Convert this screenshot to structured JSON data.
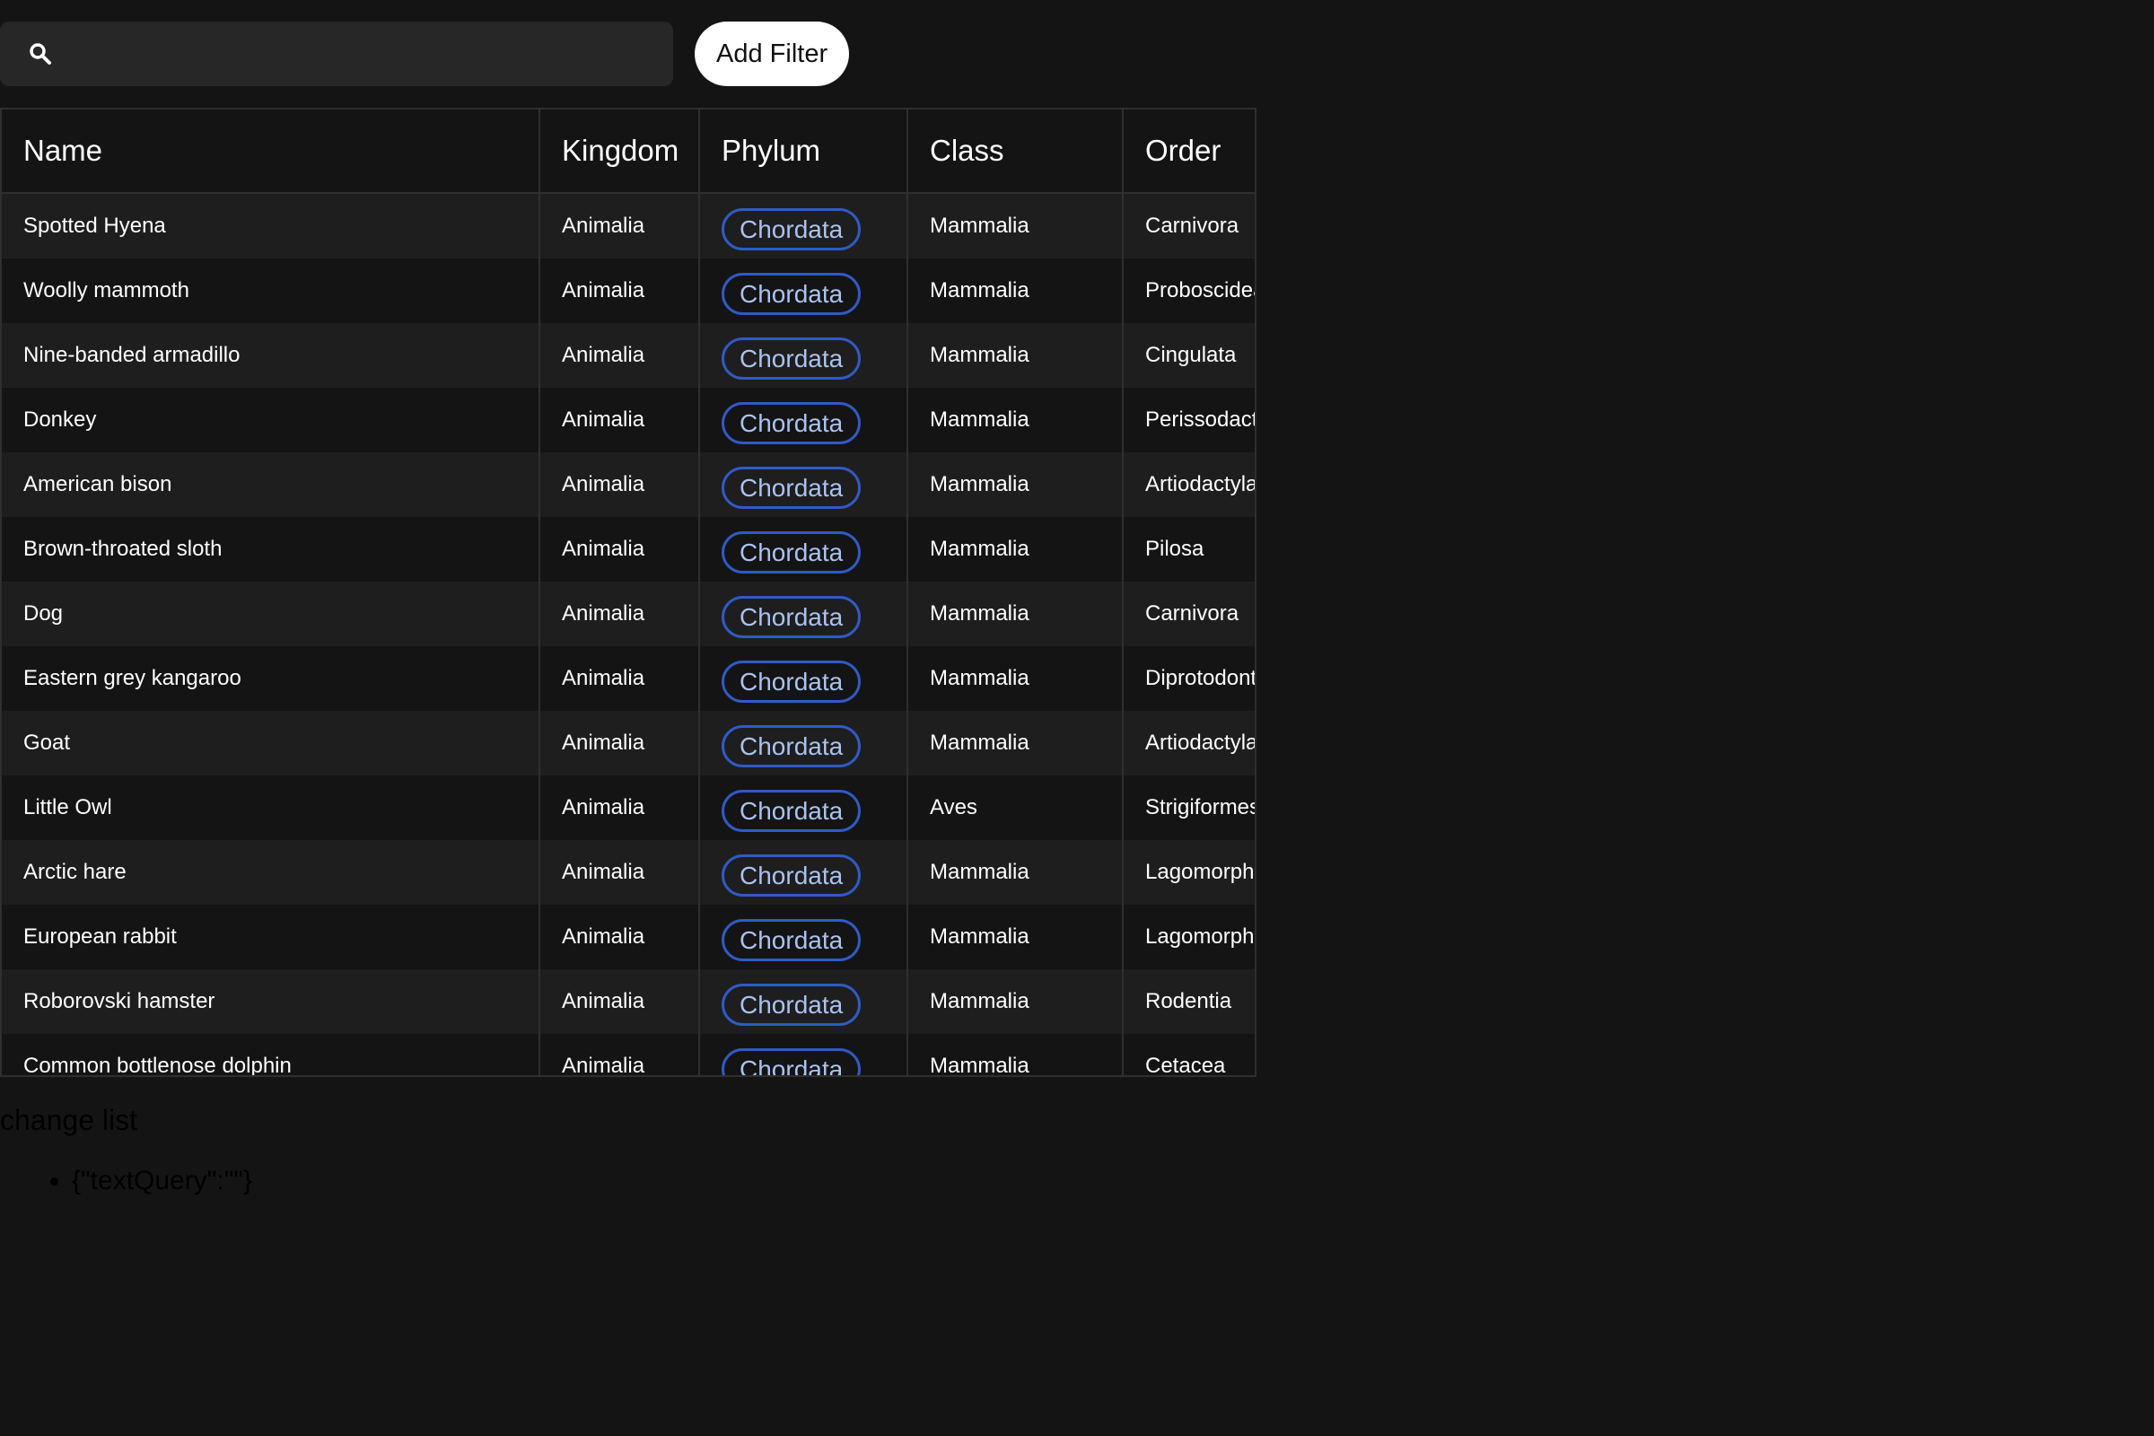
{
  "toolbar": {
    "search_placeholder": "",
    "search_value": "",
    "add_filter_label": "Add Filter"
  },
  "table": {
    "columns": [
      "Name",
      "Kingdom",
      "Phylum",
      "Class",
      "Order"
    ],
    "rows": [
      {
        "name": "Spotted Hyena",
        "kingdom": "Animalia",
        "phylum": "Chordata",
        "class": "Mammalia",
        "order": "Carnivora"
      },
      {
        "name": "Woolly mammoth",
        "kingdom": "Animalia",
        "phylum": "Chordata",
        "class": "Mammalia",
        "order": "Proboscidea"
      },
      {
        "name": "Nine-banded armadillo",
        "kingdom": "Animalia",
        "phylum": "Chordata",
        "class": "Mammalia",
        "order": "Cingulata"
      },
      {
        "name": "Donkey",
        "kingdom": "Animalia",
        "phylum": "Chordata",
        "class": "Mammalia",
        "order": "Perissodactyla"
      },
      {
        "name": "American bison",
        "kingdom": "Animalia",
        "phylum": "Chordata",
        "class": "Mammalia",
        "order": "Artiodactyla"
      },
      {
        "name": "Brown-throated sloth",
        "kingdom": "Animalia",
        "phylum": "Chordata",
        "class": "Mammalia",
        "order": "Pilosa"
      },
      {
        "name": "Dog",
        "kingdom": "Animalia",
        "phylum": "Chordata",
        "class": "Mammalia",
        "order": "Carnivora"
      },
      {
        "name": "Eastern grey kangaroo",
        "kingdom": "Animalia",
        "phylum": "Chordata",
        "class": "Mammalia",
        "order": "Diprotodontia"
      },
      {
        "name": "Goat",
        "kingdom": "Animalia",
        "phylum": "Chordata",
        "class": "Mammalia",
        "order": "Artiodactyla"
      },
      {
        "name": "Little Owl",
        "kingdom": "Animalia",
        "phylum": "Chordata",
        "class": "Aves",
        "order": "Strigiformes"
      },
      {
        "name": "Arctic hare",
        "kingdom": "Animalia",
        "phylum": "Chordata",
        "class": "Mammalia",
        "order": "Lagomorpha"
      },
      {
        "name": "European rabbit",
        "kingdom": "Animalia",
        "phylum": "Chordata",
        "class": "Mammalia",
        "order": "Lagomorpha"
      },
      {
        "name": "Roborovski hamster",
        "kingdom": "Animalia",
        "phylum": "Chordata",
        "class": "Mammalia",
        "order": "Rodentia"
      },
      {
        "name": "Common bottlenose dolphin",
        "kingdom": "Animalia",
        "phylum": "Chordata",
        "class": "Mammalia",
        "order": "Cetacea"
      }
    ]
  },
  "change_list": {
    "title": "change list",
    "items": [
      "{\"textQuery\":\"\"}"
    ]
  },
  "colors": {
    "background": "#141414",
    "row_alt": "#1e1e1e",
    "chip_border": "#2e5bc7",
    "chip_text": "#a9c3f0"
  },
  "icons": {
    "search": "search-icon"
  }
}
